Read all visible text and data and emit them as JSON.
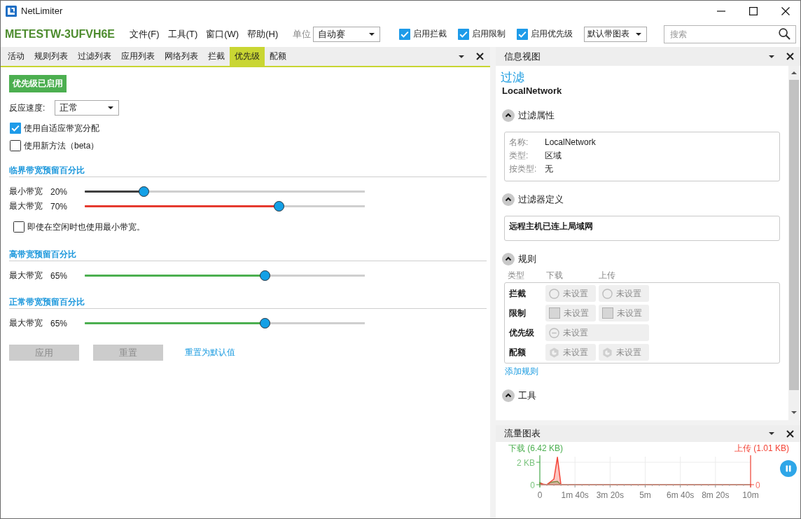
{
  "window": {
    "title": "NetLimiter"
  },
  "toolbar": {
    "machine": "METESTW-3UFVH6E",
    "menu": [
      "文件(F)",
      "工具(T)",
      "窗口(W)",
      "帮助(H)"
    ],
    "unit": {
      "label": "单位",
      "value": "自动赛"
    },
    "toggles": [
      {
        "label": "启用拦截",
        "checked": true
      },
      {
        "label": "启用限制",
        "checked": true
      },
      {
        "label": "启用优先级",
        "checked": true
      }
    ],
    "chart_mode": "默认带图表",
    "search": {
      "placeholder": "搜索"
    }
  },
  "left_panel": {
    "tabs": [
      {
        "label": "活动",
        "selected": false
      },
      {
        "label": "规则列表",
        "selected": false
      },
      {
        "label": "过滤列表",
        "selected": false
      },
      {
        "label": "应用列表",
        "selected": false
      },
      {
        "label": "网络列表",
        "selected": false
      },
      {
        "label": "拦截",
        "selected": false
      },
      {
        "label": "优先级",
        "selected": true
      },
      {
        "label": "配额",
        "selected": false
      }
    ],
    "status": "优先级已启用",
    "speed": {
      "label": "反应速度:",
      "value": "正常"
    },
    "options": [
      {
        "label": "使用自适应带宽分配",
        "checked": true
      },
      {
        "label": "使用新方法（beta）",
        "checked": false
      }
    ],
    "sections": [
      {
        "title": "临界带宽预留百分比",
        "sliders": [
          {
            "label": "最小带宽",
            "reading": "20%",
            "level": 0.2,
            "color": "#3f3f3f"
          },
          {
            "label": "最大带宽",
            "reading": "70%",
            "level": 0.7,
            "color": "#e53a2f"
          }
        ],
        "option": {
          "label": "即使在空闲时也使用最小带宽。",
          "checked": false
        }
      },
      {
        "title": "高带宽预留百分比",
        "sliders": [
          {
            "label": "最大带宽",
            "reading": "65%",
            "level": 0.65,
            "color": "#4caf50"
          }
        ]
      },
      {
        "title": "正常带宽预留百分比",
        "sliders": [
          {
            "label": "最大带宽",
            "reading": "65%",
            "level": 0.65,
            "color": "#4caf50"
          }
        ]
      }
    ],
    "buttons": [
      {
        "label": "应用",
        "disabled": true
      },
      {
        "label": "重置",
        "disabled": true
      }
    ],
    "reset_link": "重置为默认值"
  },
  "info_panel": {
    "title": "信息视图",
    "heading": "过滤",
    "name": "LocalNetwork",
    "groups": [
      {
        "kind": "properties",
        "title": "过滤属性",
        "expanded": true,
        "rows": [
          {
            "label": "名称:",
            "value": "LocalNetwork"
          },
          {
            "label": "类型:",
            "value": "区域"
          },
          {
            "label": "按类型:",
            "value": "无"
          }
        ]
      },
      {
        "kind": "definition",
        "title": "过滤器定义",
        "expanded": true,
        "text": "远程主机已连上局域网"
      },
      {
        "kind": "rules",
        "title": "规则",
        "expanded": true,
        "columns": [
          "类型",
          "下载",
          "上传"
        ],
        "rows": [
          {
            "label": "拦截",
            "cells": [
              {
                "kind": "block",
                "text": "未设置"
              },
              {
                "kind": "block",
                "text": "未设置"
              }
            ]
          },
          {
            "label": "限制",
            "cells": [
              {
                "kind": "limit",
                "text": "未设置"
              },
              {
                "kind": "limit",
                "text": "未设置"
              }
            ]
          },
          {
            "label": "优先级",
            "cells": [
              {
                "kind": "priority",
                "text": "未设置"
              }
            ]
          },
          {
            "label": "配额",
            "cells": [
              {
                "kind": "quota",
                "text": "未设置"
              },
              {
                "kind": "quota",
                "text": "未设置"
              }
            ]
          }
        ],
        "add_link": "添加规则"
      },
      {
        "kind": "tools",
        "title": "工具",
        "expanded": true
      }
    ]
  },
  "traffic_panel": {
    "title": "流量图表",
    "chart_data": {
      "type": "area",
      "grid": true,
      "categories": [
        "0",
        null,
        null,
        null,
        null,
        null,
        null,
        null,
        null,
        null,
        "1m 40s",
        null,
        null,
        null,
        null,
        null,
        null,
        null,
        null,
        null,
        "3m 20s",
        null,
        null,
        null,
        null,
        null,
        null,
        null,
        null,
        null,
        "5m",
        null,
        null,
        null,
        null,
        null,
        null,
        null,
        null,
        null,
        "6m 40s",
        null,
        null,
        null,
        null,
        null,
        null,
        null,
        null,
        null,
        "8m 20s",
        null,
        null,
        null,
        null,
        null,
        null,
        null,
        null,
        null,
        "10m"
      ],
      "ylim": [
        0,
        2.5
      ],
      "yticks": [
        0,
        {
          "value": 2,
          "label": "2 KB"
        }
      ],
      "series": [
        {
          "name": "下载 (6.42 KB)",
          "color": "#4caf50",
          "values": [
            0.2,
            0,
            0,
            0.2,
            0.25,
            0.3,
            0,
            0,
            0,
            0,
            0,
            0,
            0,
            0,
            0,
            0,
            0,
            0,
            0,
            0,
            0,
            0,
            0,
            0,
            0,
            0,
            0,
            0,
            0,
            0,
            0,
            0,
            0,
            0,
            0,
            0,
            0,
            0,
            0,
            0,
            0,
            0,
            0,
            0,
            0,
            0,
            0,
            0,
            0,
            0,
            0,
            0,
            0,
            0,
            0,
            0,
            0,
            0,
            0,
            0,
            0
          ]
        },
        {
          "name": "上传 (1.01 KB)",
          "color": "#f44336",
          "values": [
            0.15,
            0.05,
            0,
            0.25,
            0.5,
            2.45,
            0,
            0,
            0,
            0,
            0,
            0,
            0,
            0,
            0,
            0,
            0,
            0,
            0,
            0,
            0,
            0,
            0,
            0,
            0,
            0,
            0,
            0,
            0,
            0,
            0,
            0,
            0,
            0,
            0,
            0,
            0,
            0,
            0,
            0,
            0,
            0,
            0,
            0,
            0,
            0,
            0,
            0,
            0,
            0,
            0,
            0,
            0,
            0,
            0,
            0,
            0,
            0,
            0,
            0,
            0
          ]
        }
      ],
      "annotations": [
        "0"
      ]
    }
  }
}
